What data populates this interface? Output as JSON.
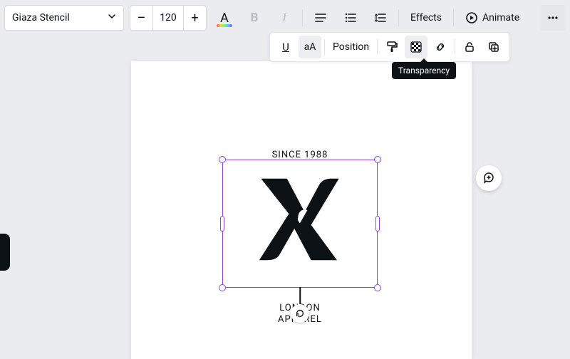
{
  "toolbar": {
    "font_name": "Giaza Stencil",
    "font_size": "120",
    "effects_label": "Effects",
    "animate_label": "Animate"
  },
  "secondary": {
    "underline_label": "U",
    "case_label": "aA",
    "position_label": "Position"
  },
  "tooltip": {
    "transparency": "Transparency"
  },
  "canvas": {
    "since_text": "SINCE 1988",
    "london_line1": "LONDON",
    "london_line2": "APPAREL"
  }
}
